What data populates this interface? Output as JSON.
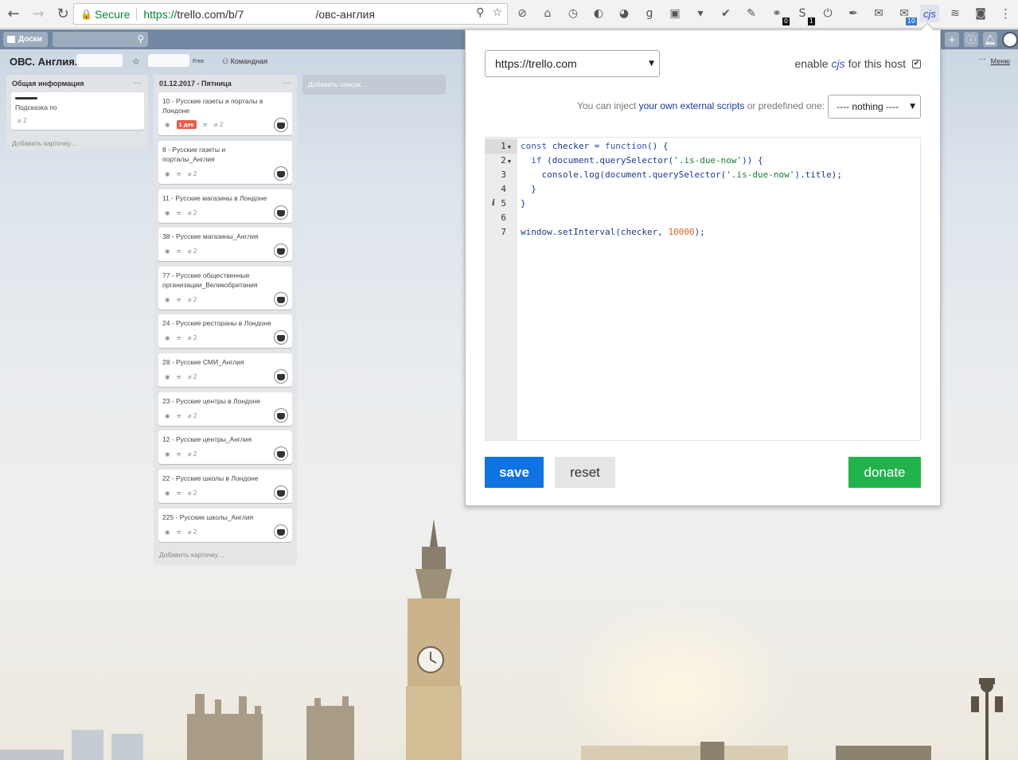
{
  "browser": {
    "secure_label": "Secure",
    "url_proto": "https://",
    "url_host": "trello.com/b/7",
    "url_path": "/овс-англия",
    "extensions": [
      {
        "icon": "eye-slash-icon",
        "glyph": "⊘"
      },
      {
        "icon": "inbox-icon",
        "glyph": "⌂"
      },
      {
        "icon": "clock-icon",
        "glyph": "◷"
      },
      {
        "icon": "half-moon-icon",
        "glyph": "◐"
      },
      {
        "icon": "color-circle-icon",
        "glyph": "◕"
      },
      {
        "icon": "g-icon",
        "glyph": "g"
      },
      {
        "icon": "screenshot-icon",
        "glyph": "▣"
      },
      {
        "icon": "pocket-icon",
        "glyph": "▾"
      },
      {
        "icon": "checkmark-icon",
        "glyph": "✔"
      },
      {
        "icon": "wrench-icon",
        "glyph": "✎"
      },
      {
        "icon": "link-icon",
        "glyph": "⚭",
        "badge": "0"
      },
      {
        "icon": "s-icon",
        "glyph": "S",
        "badge": "1"
      },
      {
        "icon": "power-icon",
        "glyph": "⏻"
      },
      {
        "icon": "eyedropper-icon",
        "glyph": "✒"
      },
      {
        "icon": "envelope-icon",
        "glyph": "✉"
      },
      {
        "icon": "mail-icon",
        "glyph": "✉",
        "badge": "10",
        "badge_color": "blue"
      }
    ],
    "cjs_label": "cjs",
    "menu_glyph": "⋮"
  },
  "trello": {
    "boards_label": "Доски",
    "board_title": "ОВС. Англия.",
    "free_label": "Free",
    "team_label": "Командная",
    "menu_label": "Меню",
    "add_list_label": "Добавить список…",
    "lists": [
      {
        "title": "Общая информация",
        "cards": [
          {
            "title": "Подсказка по",
            "attachments": "2"
          }
        ],
        "add_card": "Добавить карточку…"
      },
      {
        "title": "01.12.2017 - Пятница",
        "cards": [
          {
            "title": "10 - Русские газеты и порталы в Лондоне",
            "due": "1 дек",
            "attachments": "2"
          },
          {
            "title": "8 - Русские газеты и порталы_Англия",
            "attachments": "2"
          },
          {
            "title": "11 - Русские магазины в Лондоне",
            "attachments": "2"
          },
          {
            "title": "38 - Русские магазины_Англия",
            "attachments": "2"
          },
          {
            "title": "77 - Русские общественные организации_Великобритания",
            "attachments": "2"
          },
          {
            "title": "24 - Русские рестораны в Лондоне",
            "attachments": "2"
          },
          {
            "title": "28 - Русские СМИ_Англия",
            "attachments": "2"
          },
          {
            "title": "23 - Русские центры в Лондоне",
            "attachments": "2"
          },
          {
            "title": "12 - Русские центры_Англия",
            "attachments": "2"
          },
          {
            "title": "22 - Русские школы в Лондоне",
            "attachments": "2"
          },
          {
            "title": "225 - Русские школы_Англия",
            "attachments": "2"
          }
        ],
        "add_card": "Добавить карточку…"
      }
    ]
  },
  "popup": {
    "host_value": "https://trello.com",
    "enable_prefix": "enable",
    "enable_cjs": "cjs",
    "enable_suffix": "for this host",
    "enable_checked": true,
    "inject_prefix": "You can inject",
    "inject_link": "your own external scripts",
    "inject_suffix": "or predefined one:",
    "predefined_value": "---- nothing ----",
    "code_lines": [
      "const checker = function() {",
      "  if (document.querySelector('.is-due-now')) {",
      "    console.log(document.querySelector('.is-due-now').title);",
      "  }",
      "}",
      "",
      "window.setInterval(checker, 10000);"
    ],
    "save_label": "save",
    "reset_label": "reset",
    "donate_label": "donate"
  }
}
